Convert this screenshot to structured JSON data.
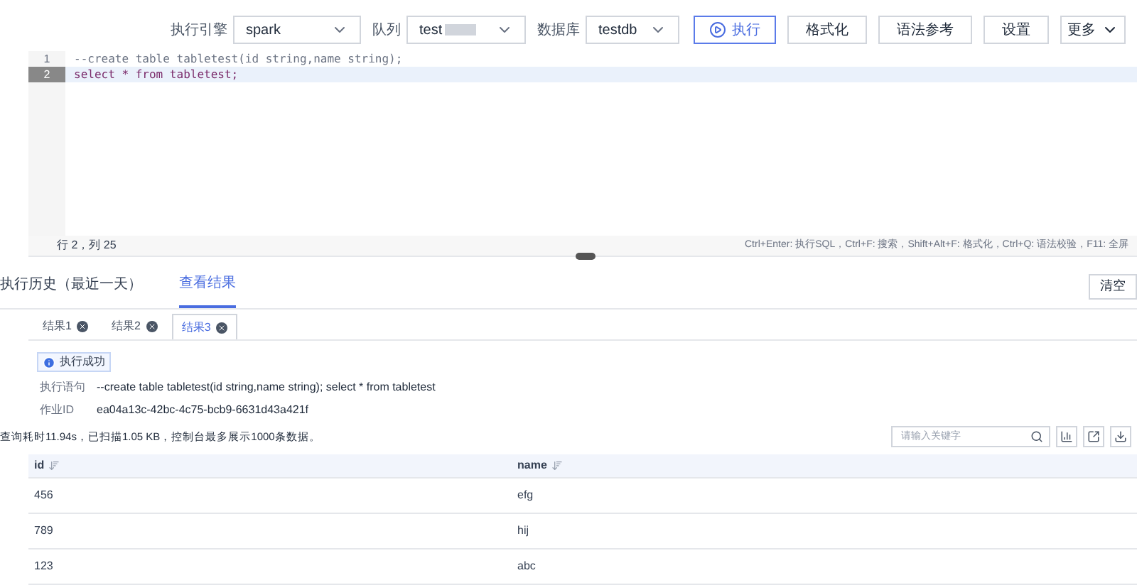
{
  "toolbar": {
    "engine": {
      "label": "执行引擎",
      "value": "spark"
    },
    "queue": {
      "label": "队列",
      "value": "test"
    },
    "database": {
      "label": "数据库",
      "value": "testdb"
    },
    "buttons": [
      {
        "kind": "run",
        "label": "执行"
      },
      {
        "kind": "plain",
        "label": "格式化"
      },
      {
        "kind": "plain",
        "label": "语法参考"
      },
      {
        "kind": "plain",
        "label": "设置"
      },
      {
        "kind": "menu",
        "label": "更多"
      }
    ]
  },
  "editor": {
    "lines": [
      {
        "number": "1",
        "text": "--create table tabletest(id string,name string);",
        "kind": "comment",
        "selected": false
      },
      {
        "number": "2",
        "text": "select * from tabletest;",
        "kind": "code",
        "selected": true
      }
    ],
    "position": "行 2，列 25",
    "shortcuts": "Ctrl+Enter: 执行SQL，Ctrl+F: 搜索，Shift+Alt+F: 格式化，Ctrl+Q: 语法校验，F11: 全屏"
  },
  "tabs": [
    {
      "label": "执行历史（最近一天）",
      "selected": false
    },
    {
      "label": "查看结果",
      "selected": true
    }
  ],
  "clear_button": "清空",
  "result_tabs": [
    {
      "label": "结果1",
      "selected": false
    },
    {
      "label": "结果2",
      "selected": false
    },
    {
      "label": "结果3",
      "selected": true
    }
  ],
  "status": "执行成功",
  "details": [
    {
      "label": "执行语句",
      "value": "--create table tabletest(id string,name string); select * from tabletest"
    },
    {
      "label": "作业ID",
      "value": "ea04a13c-42bc-4c75-bcb9-6631d43a421f"
    }
  ],
  "summary": "查询耗时11.94s，已扫描1.05 KB，控制台最多展示1000条数据。",
  "search": {
    "placeholder": "请输入关键字"
  },
  "table": {
    "columns": [
      "id",
      "name"
    ],
    "rows": [
      [
        "456",
        "efg"
      ],
      [
        "789",
        "hij"
      ],
      [
        "123",
        "abc"
      ]
    ]
  }
}
